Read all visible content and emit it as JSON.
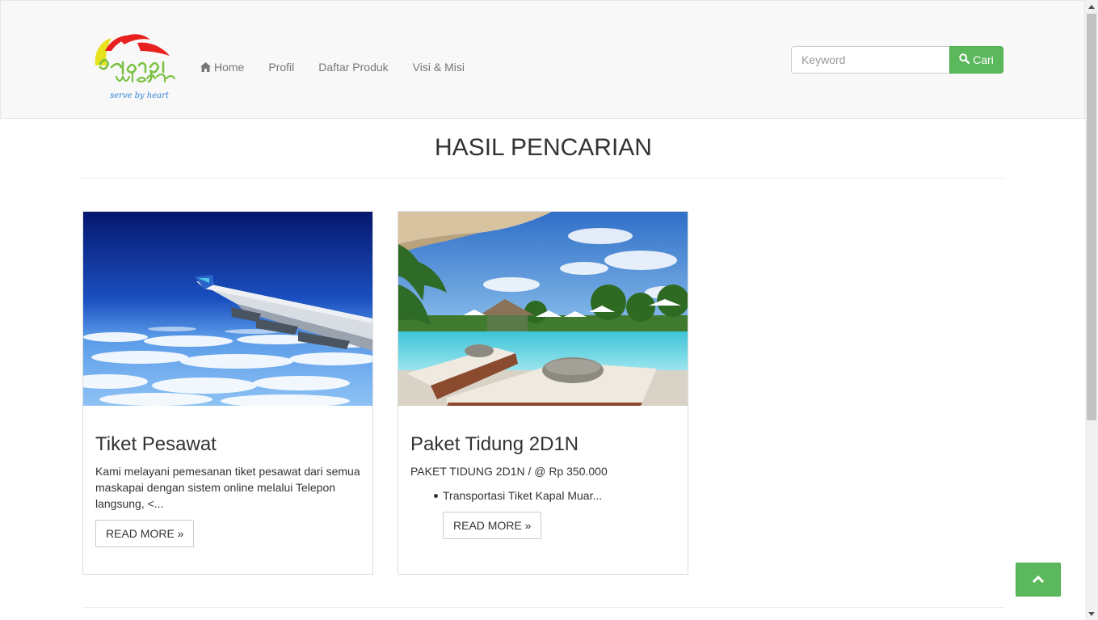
{
  "brand": {
    "logo_text": "pelangi wisata",
    "tagline": "serve by heart"
  },
  "nav": {
    "items": [
      {
        "label": "Home",
        "icon": "home-icon"
      },
      {
        "label": "Profil"
      },
      {
        "label": "Daftar Produk"
      },
      {
        "label": "Visi & Misi"
      }
    ]
  },
  "search": {
    "placeholder": "Keyword",
    "value": "",
    "button_label": "Cari",
    "button_icon": "search-icon"
  },
  "main": {
    "title": "HASIL PENCARIAN",
    "results": [
      {
        "title": "Tiket Pesawat",
        "image": "airplane-wing-over-clouds",
        "excerpt": "Kami melayani pemesanan tiket pesawat dari semua maskapai dengan sistem online melalui Telepon langsung, <...",
        "button_label": "READ MORE »"
      },
      {
        "title": "Paket Tidung 2D1N",
        "image": "resort-pool-with-loungers",
        "excerpt": "PAKET TIDUNG 2D1N / @ Rp 350.000",
        "bullets": [
          "Transportasi Tiket Kapal Muar..."
        ],
        "button_label": "READ MORE »"
      }
    ]
  },
  "back_to_top": {
    "icon": "chevron-up-icon"
  },
  "colors": {
    "accent": "#5cb85c",
    "navbar_bg": "#f8f8f8",
    "nav_text": "#777777",
    "text": "#333333"
  }
}
